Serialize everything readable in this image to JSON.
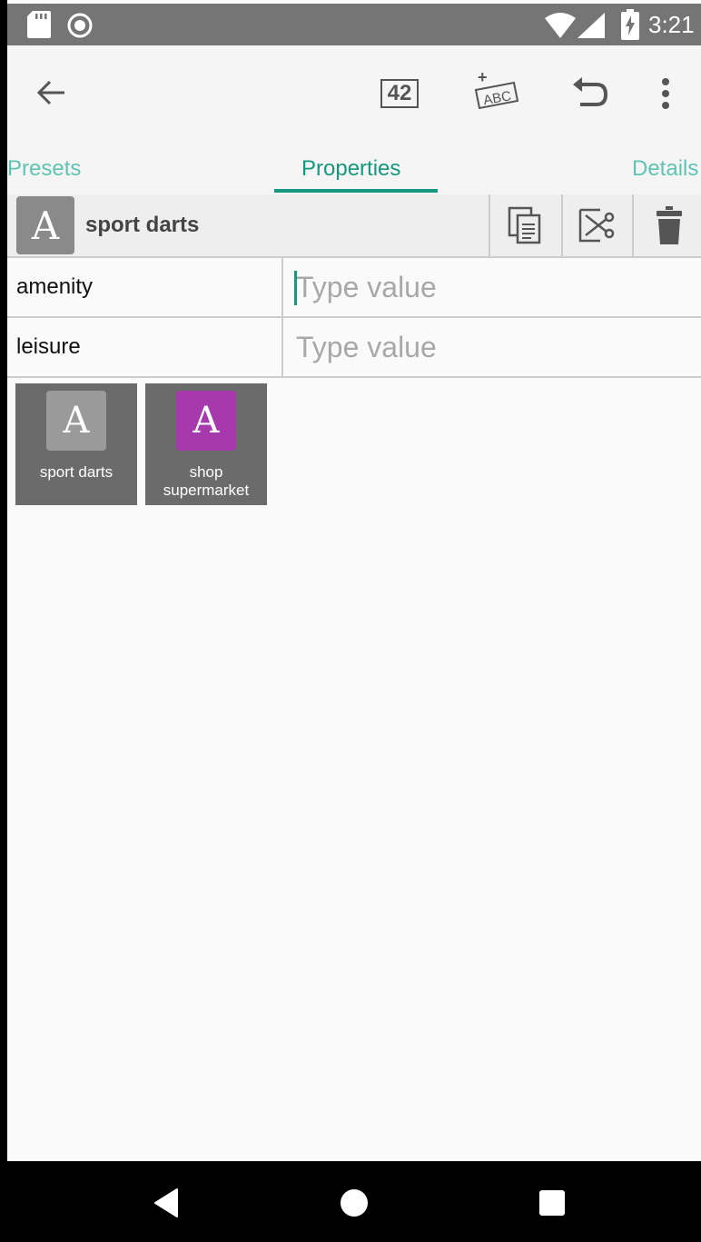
{
  "status_bar": {
    "time": "3:21",
    "icons": [
      "sd-card-icon",
      "circle-icon",
      "wifi-icon",
      "signal-icon",
      "battery-charging-icon"
    ]
  },
  "toolbar": {
    "back_icon": "arrow-left-icon",
    "counter_label": "42",
    "add_abc_plus": "+",
    "add_abc_label": "ABC",
    "undo_icon": "undo-icon",
    "more_icon": "more-vert-icon"
  },
  "tabs": [
    {
      "label": "Presets",
      "selected": false
    },
    {
      "label": "Properties",
      "selected": true
    },
    {
      "label": "Details",
      "selected": false
    }
  ],
  "header": {
    "avatar_letter": "A",
    "preset_name": "sport darts",
    "actions": [
      "copy-icon",
      "cut-icon",
      "trash-icon"
    ]
  },
  "tags": [
    {
      "key": "amenity",
      "value": "",
      "placeholder": "Type value"
    },
    {
      "key": "leisure",
      "value": "",
      "placeholder": "Type value"
    }
  ],
  "presets": [
    {
      "letter": "A",
      "label": "sport darts",
      "color": "#9a9a9a"
    },
    {
      "letter": "A",
      "label_line1": "shop",
      "label_line2": "supermarket",
      "color": "#a63aad"
    }
  ],
  "colors": {
    "accent": "#16977f",
    "tab_inactive": "#5fc4b4",
    "tile_bg": "#6b6b6b",
    "status_bar": "#757575"
  },
  "nav_bar": {
    "icons": [
      "nav-back-icon",
      "nav-home-icon",
      "nav-recents-icon"
    ]
  }
}
